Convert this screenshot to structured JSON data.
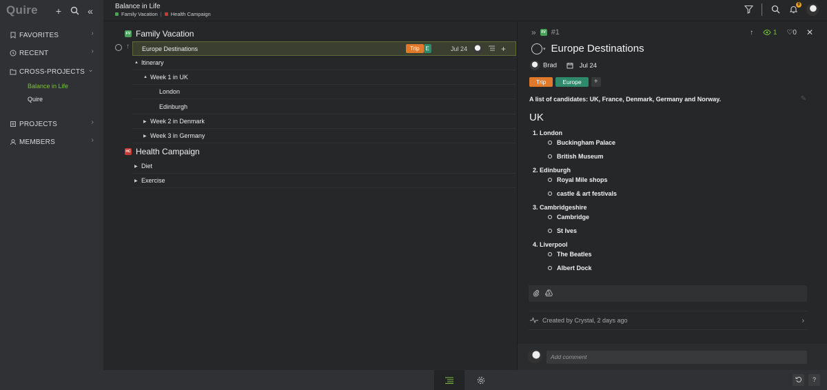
{
  "app": {
    "logo": "Quire"
  },
  "colors": {
    "accent_green": "#7bc142",
    "trip": "#e07a2a",
    "europe": "#2e8a6a",
    "fv_tag": "#4aa35a",
    "hc_tag": "#c83a34"
  },
  "sidebar": {
    "tools": {
      "add_icon": "+",
      "search_icon": "⌕",
      "collapse_icon": "«"
    },
    "sections": [
      {
        "label": "FAVORITES",
        "icon": "bookmark-icon"
      },
      {
        "label": "RECENT",
        "icon": "clock-icon"
      },
      {
        "label": "CROSS-PROJECTS",
        "icon": "folder-icon"
      },
      {
        "label": "PROJECTS",
        "icon": "projects-icon"
      },
      {
        "label": "MEMBERS",
        "icon": "members-icon"
      }
    ],
    "cross_projects": [
      {
        "label": "Balance in Life",
        "active": true
      },
      {
        "label": "Quire",
        "active": false
      }
    ]
  },
  "header": {
    "title": "Balance in Life",
    "crumbs": [
      {
        "label": "Family Vacation"
      },
      {
        "label": "Health Campaign"
      }
    ],
    "crumb_sep": "|",
    "notif_count": "9"
  },
  "list": {
    "projects": [
      {
        "tag": "FV",
        "name": "Family Vacation"
      },
      {
        "tag": "HC",
        "name": "Health Campaign"
      }
    ],
    "rows": [
      {
        "text": "Europe Destinations",
        "selected": true,
        "tags": [
          {
            "label": "Trip"
          },
          {
            "label": "E"
          }
        ],
        "date": "Jul 24",
        "add": "+"
      },
      {
        "text": "Itinerary",
        "expand": "▲"
      },
      {
        "text": "Week 1 in UK",
        "expand": "▲"
      },
      {
        "text": "London"
      },
      {
        "text": "Edinburgh"
      },
      {
        "text": "Week 2 in Denmark",
        "expand": "▶"
      },
      {
        "text": "Week 3 in Germany",
        "expand": "▶"
      },
      {
        "text": "Diet",
        "expand": "▶"
      },
      {
        "text": "Exercise",
        "expand": "▶"
      }
    ]
  },
  "detail": {
    "task_id": "#1",
    "project_tag": "FV",
    "watchers": "1",
    "likes": "0",
    "title": "Europe Destinations",
    "assignee": "Brad",
    "due": "Jul 24",
    "tags": [
      {
        "label": "Trip"
      },
      {
        "label": "Europe"
      }
    ],
    "add_tag": "+",
    "description": "A list of candidates: UK, France, Denmark, Germany and Norway.",
    "heading": "UK",
    "outline": [
      {
        "label": "1. London",
        "items": [
          "Buckingham Palace",
          "British Museum"
        ]
      },
      {
        "label": "2. Edinburgh",
        "items": [
          "Royal Mile shops",
          "castle & art festivals"
        ]
      },
      {
        "label": "3. Cambridgeshire",
        "items": [
          "Cambridge",
          "St Ives"
        ]
      },
      {
        "label": "4. Liverpool",
        "items": [
          "The Beatles",
          "Albert Dock"
        ]
      }
    ],
    "created": "Created by Crystal, 2 days ago",
    "comment_placeholder": "Add comment"
  },
  "bottom": {
    "help": "?"
  }
}
